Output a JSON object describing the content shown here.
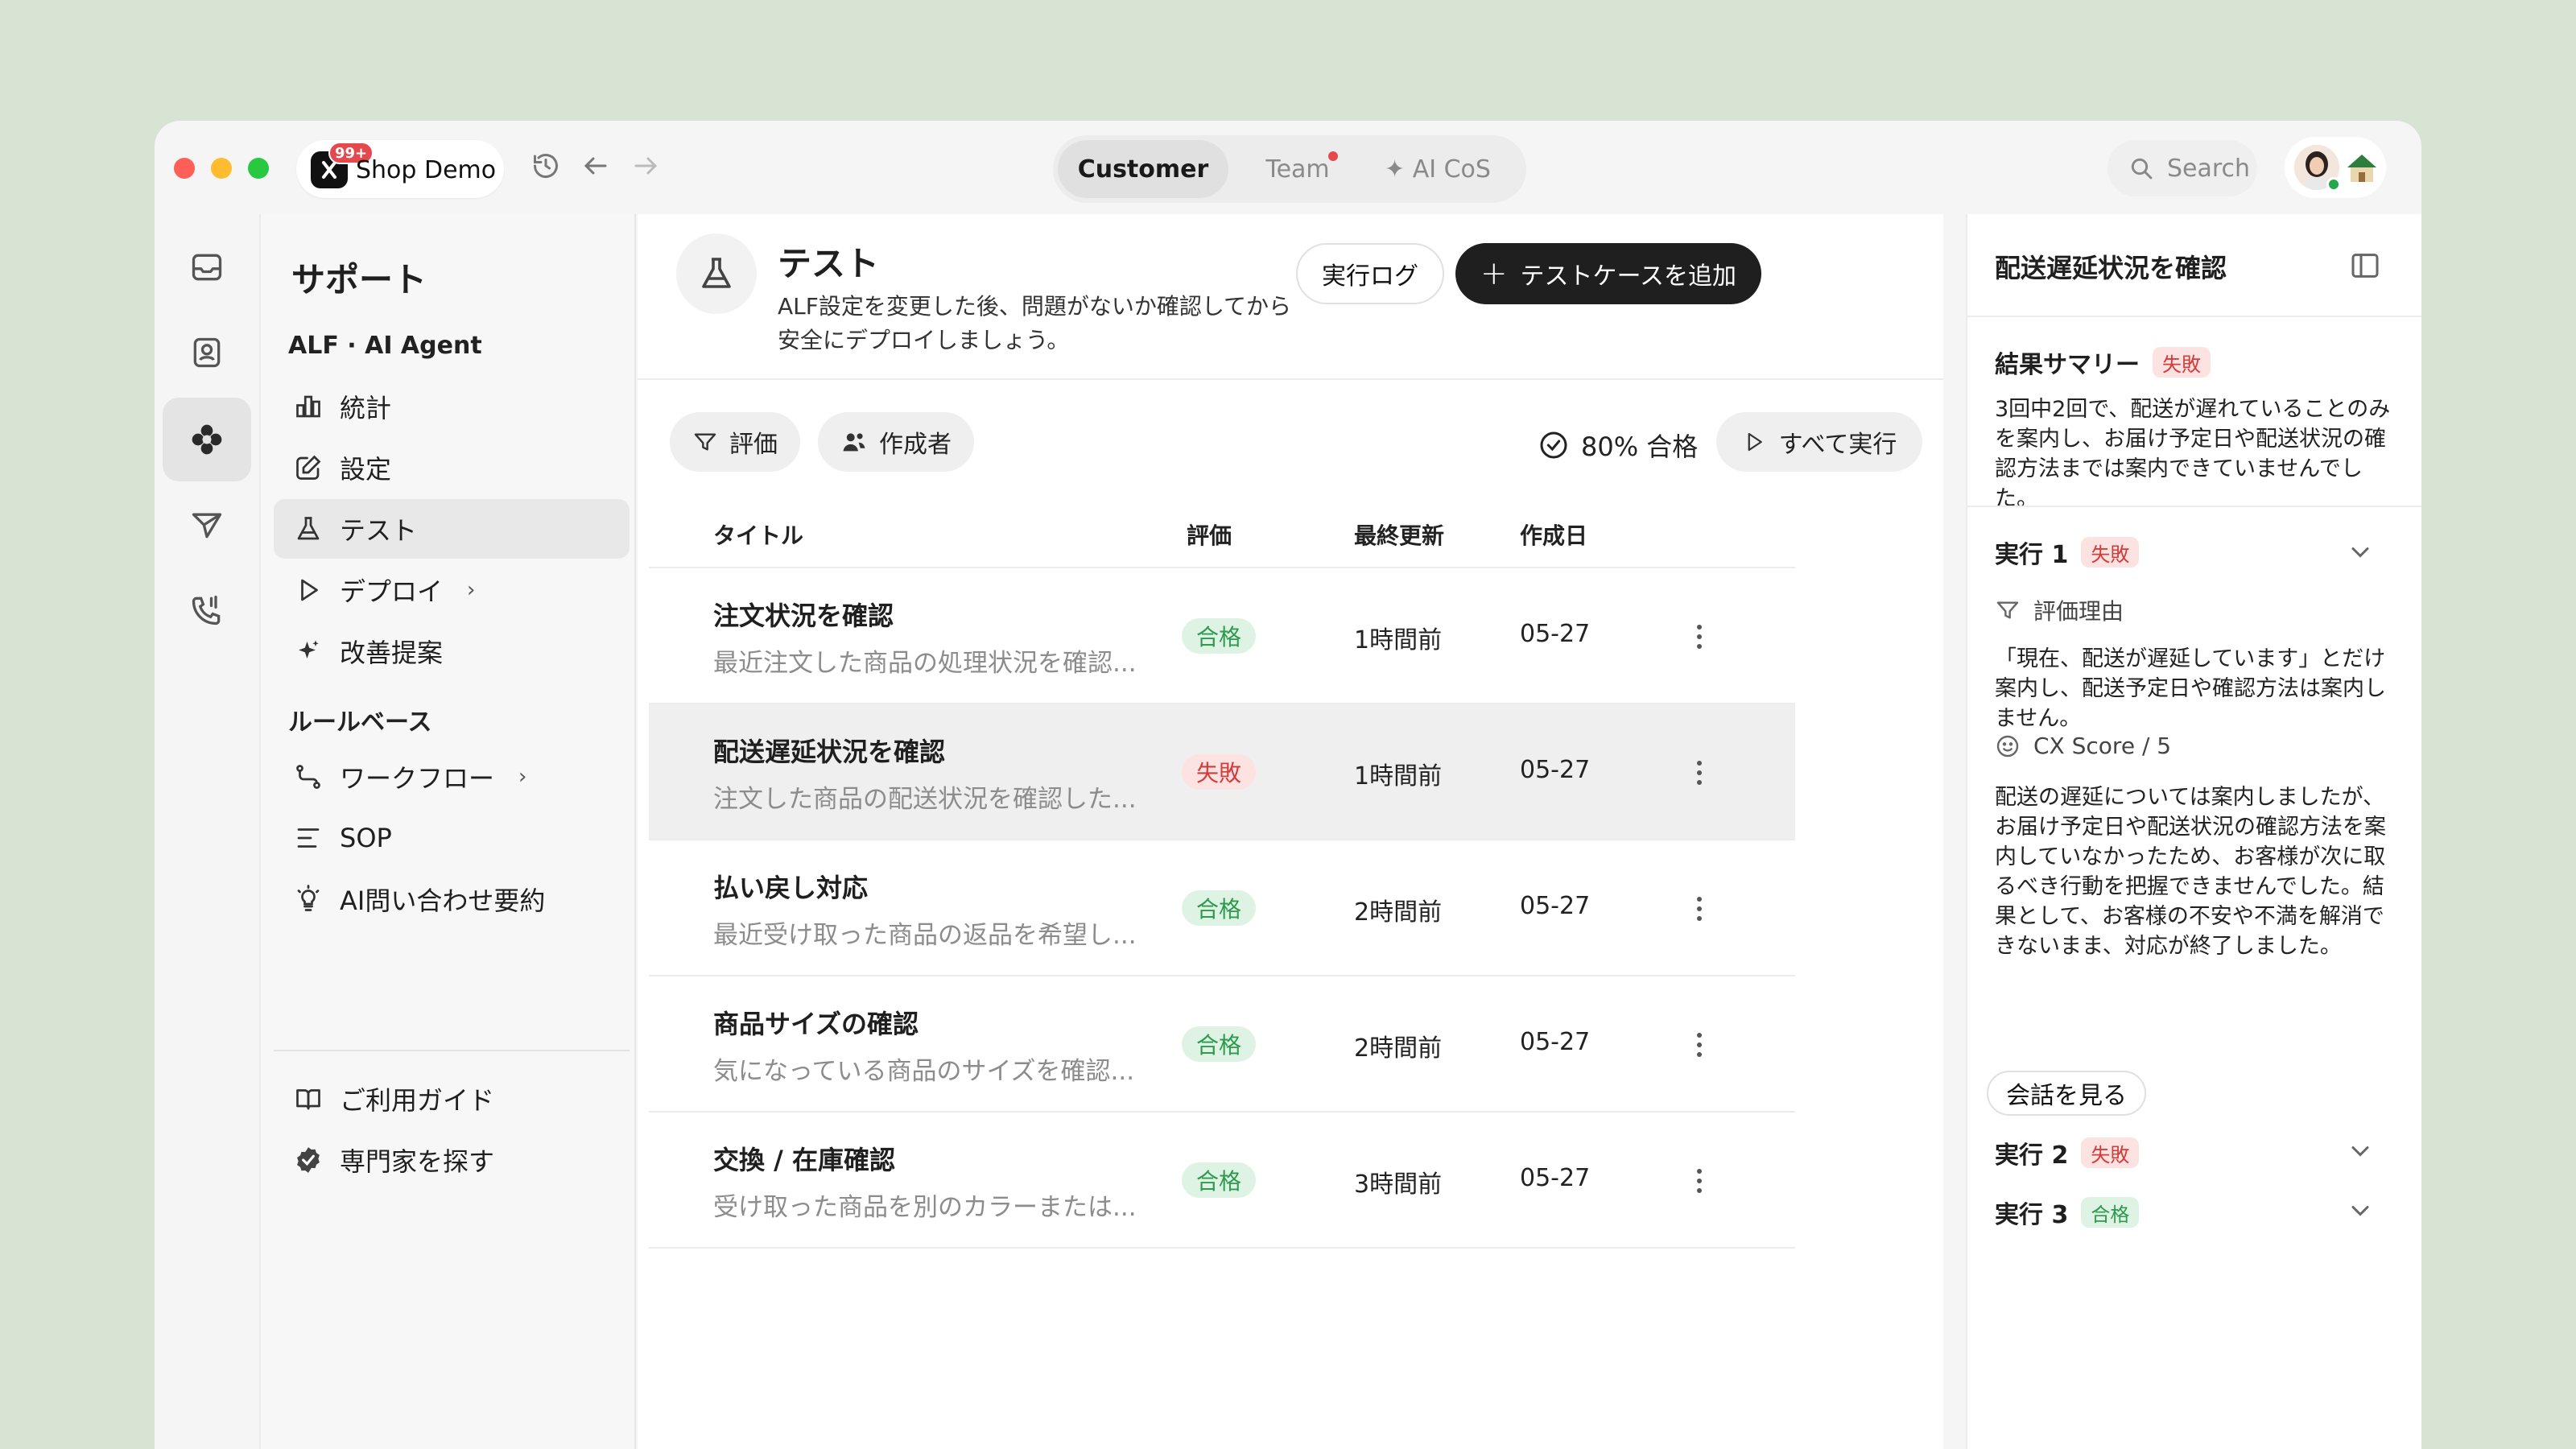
{
  "titlebar": {
    "workspace_name": "Shop Demo",
    "workspace_badge": "99+",
    "tabs": [
      {
        "label": "Customer",
        "active": true
      },
      {
        "label": "Team",
        "has_dot": true
      },
      {
        "label": "✦ AI CoS"
      }
    ],
    "search_label": "Search"
  },
  "sidebar": {
    "title": "サポート",
    "section_alf": "ALF · AI Agent",
    "items_alf": [
      {
        "label": "統計",
        "icon": "bar-chart-icon"
      },
      {
        "label": "設定",
        "icon": "edit-icon"
      },
      {
        "label": "テスト",
        "icon": "flask-icon",
        "active": true
      },
      {
        "label": "デプロイ",
        "icon": "play-icon",
        "chevron": true
      },
      {
        "label": "改善提案",
        "icon": "sparkle-icon"
      }
    ],
    "section_rules": "ルールベース",
    "items_rules": [
      {
        "label": "ワークフロー",
        "icon": "workflow-icon",
        "chevron": true
      },
      {
        "label": "SOP",
        "icon": "list-icon"
      },
      {
        "label": "AI問い合わせ要約",
        "icon": "bulb-icon"
      }
    ],
    "items_footer": [
      {
        "label": "ご利用ガイド",
        "icon": "book-icon"
      },
      {
        "label": "専門家を探す",
        "icon": "verified-icon"
      }
    ]
  },
  "main": {
    "title": "テスト",
    "description": "ALF設定を変更した後、問題がないか確認してから安全にデプロイしましょう。",
    "log_button": "実行ログ",
    "add_button": "テストケースを追加",
    "filter_eval": "評価",
    "filter_author": "作成者",
    "pass_rate": "80% 合格",
    "run_all": "すべて実行",
    "columns": {
      "title": "タイトル",
      "eval": "評価",
      "updated": "最終更新",
      "created": "作成日"
    },
    "rows": [
      {
        "title": "注文状況を確認",
        "desc": "最近注文した商品の処理状況を確認...",
        "status": "合格",
        "updated": "1時間前",
        "created": "05-27"
      },
      {
        "title": "配送遅延状況を確認",
        "desc": "注文した商品の配送状況を確認した...",
        "status": "失敗",
        "updated": "1時間前",
        "created": "05-27",
        "selected": true
      },
      {
        "title": "払い戻し対応",
        "desc": "最近受け取った商品の返品を希望し...",
        "status": "合格",
        "updated": "2時間前",
        "created": "05-27"
      },
      {
        "title": "商品サイズの確認",
        "desc": "気になっている商品のサイズを確認...",
        "status": "合格",
        "updated": "2時間前",
        "created": "05-27"
      },
      {
        "title": "交換 / 在庫確認",
        "desc": "受け取った商品を別のカラーまたは...",
        "status": "合格",
        "updated": "3時間前",
        "created": "05-27"
      }
    ]
  },
  "panel": {
    "title": "配送遅延状況を確認",
    "summary_label": "結果サマリー",
    "summary_status": "失敗",
    "summary_text": "3回中2回で、配送が遅れていることのみを案内し、お届け予定日や配送状況の確認方法までは案内できていませんでした。",
    "run1_label": "実行 1",
    "run1_status": "失敗",
    "reason_label": "評価理由",
    "reason_text": "「現在、配送が遅延しています」とだけ案内し、配送予定日や確認方法は案内しません。",
    "cx_label": "CX Score / 5",
    "cx_text": "配送の遅延については案内しましたが、お届け予定日や配送状況の確認方法を案内していなかったため、お客様が次に取るべき行動を把握できませんでした。結果として、お客様の不安や不満を解消できないまま、対応が終了しました。",
    "view_conversation": "会話を見る",
    "run2_label": "実行 2",
    "run2_status": "失敗",
    "run3_label": "実行 3",
    "run3_status": "合格"
  },
  "colors": {
    "background": "#d7e4d3",
    "pass": "#2d9a4e",
    "fail": "#d43c3c",
    "primary_button": "#1f1f1f"
  }
}
